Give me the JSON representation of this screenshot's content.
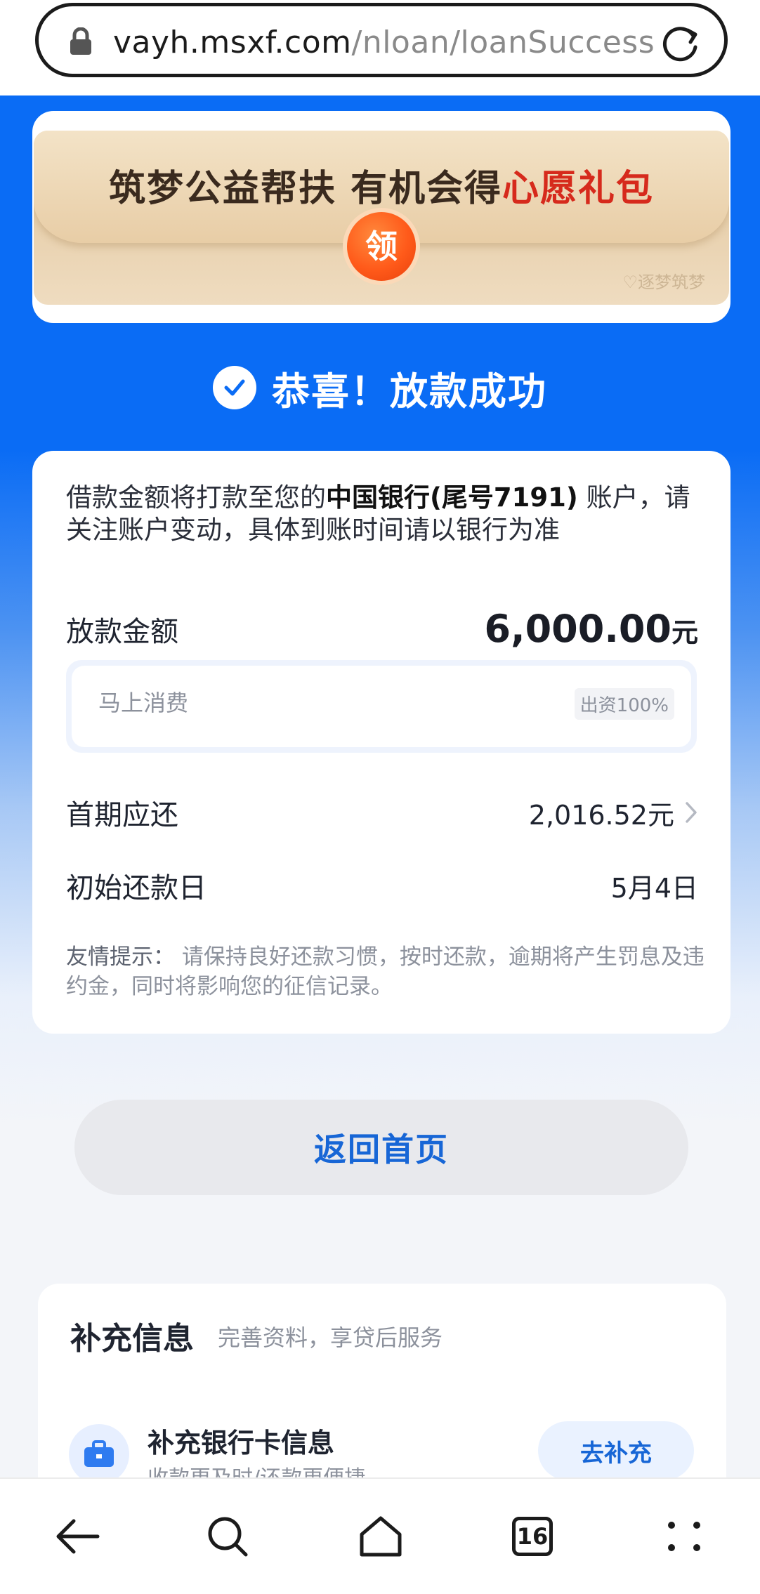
{
  "browser": {
    "url_host": "vayh.msxf.com",
    "url_path": "/nloan/loanSuccess",
    "tab_count": "16"
  },
  "banner": {
    "title_main": "筑梦公益帮扶 有机会得",
    "title_highlight": "心愿礼包",
    "stamp": "领",
    "watermark": "♡逐梦筑梦"
  },
  "success": {
    "text": "恭喜！放款成功"
  },
  "loan": {
    "notice_prefix": "借款金额将打款至您的",
    "bank": "中国银行(尾号7191)",
    "notice_suffix": " 账户，请关注账户变动，具体到账时间请以银行为准",
    "amount_label": "放款金额",
    "amount_value": "6,000.00",
    "amount_unit": "元",
    "lender_name": "马上消费",
    "lender_share": "出资100%",
    "first_payment_label": "首期应还",
    "first_payment_value": "2,016.52元",
    "start_date_label": "初始还款日",
    "start_date_value": "5月4日",
    "tip_label": "友情提示：",
    "tip_text": " 请保持良好还款习惯，按时还款，逾期将产生罚息及违约金，同时将影响您的征信记录。"
  },
  "actions": {
    "return_home": "返回首页"
  },
  "supplement": {
    "title": "补充信息",
    "subtitle": "完善资料，享贷后服务",
    "bank_title": "补充银行卡信息",
    "bank_subtitle": "收款更及时/还款更便捷",
    "bank_button": "去补充"
  },
  "colors": {
    "accent_blue": "#0a6cf5",
    "highlight_red": "#d62a1c",
    "button_text_blue": "#1766d6"
  }
}
